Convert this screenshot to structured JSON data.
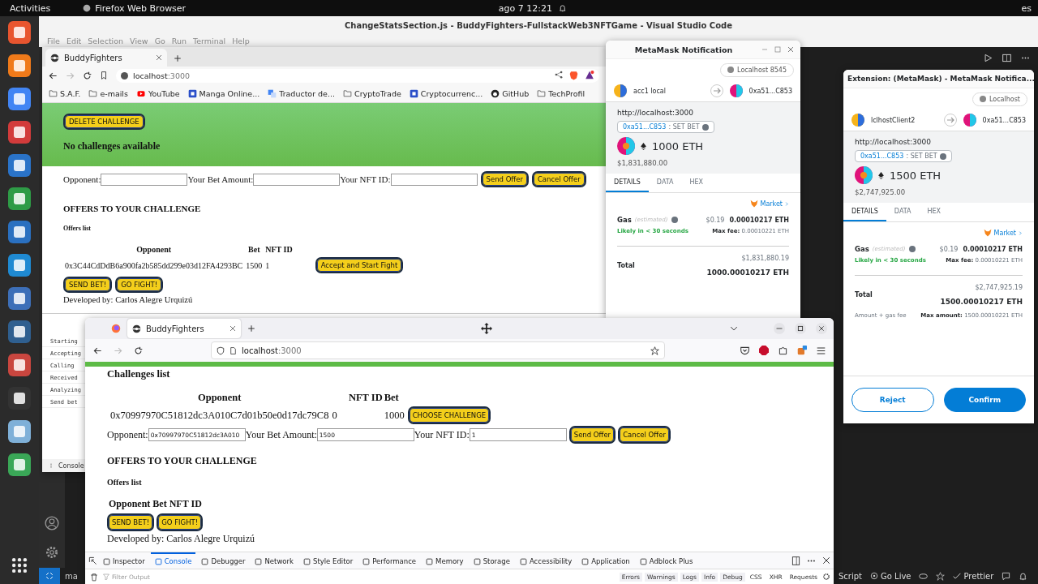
{
  "top_bar": {
    "activities": "Activities",
    "app_name": "Firefox Web Browser",
    "clock": "ago 7  12:21",
    "input_source": "es"
  },
  "editor": {
    "title": "ChangeStatsSection.js - BuddyFighters-FullstackWeb3NFTGame - Visual Studio Code",
    "menu": [
      "File",
      "Edit",
      "Selection",
      "View",
      "Go",
      "Run",
      "Terminal",
      "Help"
    ],
    "branch": "ma",
    "status_items": [
      "Script",
      "Go Live",
      "Prettier"
    ]
  },
  "back_browser": {
    "tab": "BuddyFighters",
    "url_host": "localhost",
    "url_port": ":3000",
    "bookmarks": [
      {
        "label": "S.A.F.",
        "kind": "folder"
      },
      {
        "label": "e-mails",
        "kind": "folder"
      },
      {
        "label": "YouTube",
        "kind": "video"
      },
      {
        "label": "Manga Online...",
        "kind": "site"
      },
      {
        "label": "Traductor de...",
        "kind": "translate"
      },
      {
        "label": "CryptoTrade",
        "kind": "folder"
      },
      {
        "label": "Cryptocurrenc...",
        "kind": "site"
      },
      {
        "label": "GitHub",
        "kind": "github"
      },
      {
        "label": "TechProfil",
        "kind": "folder"
      }
    ],
    "delete_button": "DELETE CHALLENGE",
    "no_challenges": "No challenges available",
    "form": {
      "opponent_label": "Opponent:",
      "bet_label": "Your Bet Amount:",
      "nft_label": "Your NFT ID:",
      "send_offer": "Send Offer",
      "cancel_offer": "Cancel Offer"
    },
    "offers_heading": "OFFERS TO YOUR CHALLENGE",
    "offers_list": "Offers list",
    "offer_columns": [
      "Opponent",
      "Bet",
      "NFT ID"
    ],
    "offers": [
      {
        "opponent": "0x3C44CdDdB6a900fa2b585dd299e03d12FA4293BC",
        "bet": "1500",
        "nft_id": "1"
      }
    ],
    "accept_button": "Accept and Start Fight",
    "send_bet": "SEND BET!",
    "go_fight": "GO FIGHT!",
    "footer": "Developed by: Carlos Alegre Urquizú",
    "console_lines": [
      "Starting",
      "Accepting",
      "Calling",
      "Received",
      "Analyzing",
      "Send bet"
    ],
    "console_tab": "Console"
  },
  "metamask_windows": [
    {
      "title": "MetaMask Notification",
      "network": "Localhost 8545",
      "from": "acc1 local",
      "to": "0xa51...C853",
      "origin": "http://localhost:3000",
      "contract": "0xa51...C853",
      "method": ": SET BET",
      "amount": "1000 ETH",
      "fiat": "$1,831,880.00",
      "tabs": [
        {
          "label": "DETAILS",
          "selected": true
        },
        {
          "label": "DATA",
          "selected": false
        },
        {
          "label": "HEX",
          "selected": false
        }
      ],
      "market": "Market",
      "gas_label": "Gas",
      "gas_note": "(estimated)",
      "gas_fiat": "$0.19",
      "gas_eth": "0.00010217 ETH",
      "likely": "Likely in < 30 seconds",
      "max_fee_label": "Max fee:",
      "max_fee": "0.00010221 ETH",
      "total_label": "Total",
      "total_fiat": "$1,831,880.19",
      "total_eth": "1000.00010217 ETH"
    },
    {
      "title": "Extension: (MetaMask) - MetaMask Notifica...",
      "network": "Localhost",
      "from": "lclhostClient2",
      "to": "0xa51...C853",
      "origin": "http://localhost:3000",
      "contract": "0xa51...C853",
      "method": ": SET BET",
      "amount": "1500 ETH",
      "fiat": "$2,747,925.00",
      "tabs": [
        {
          "label": "DETAILS",
          "selected": true
        },
        {
          "label": "DATA",
          "selected": false
        },
        {
          "label": "HEX",
          "selected": false
        }
      ],
      "market": "Market",
      "gas_label": "Gas",
      "gas_note": "(estimated)",
      "gas_fiat": "$0.19",
      "gas_eth": "0.00010217 ETH",
      "likely": "Likely in < 30 seconds",
      "max_fee_label": "Max fee:",
      "max_fee": "0.00010221 ETH",
      "total_label": "Total",
      "total_fiat": "$2,747,925.19",
      "total_eth": "1500.00010217 ETH",
      "amount_gas": "Amount + gas fee",
      "max_amount_label": "Max amount:",
      "max_amount": "1500.00010221 ETH",
      "reject": "Reject",
      "confirm": "Confirm"
    }
  ],
  "front_browser": {
    "tab": "BuddyFighters",
    "url_host": "localhost",
    "url_port": ":3000",
    "challenges_heading": "Challenges list",
    "challenge_columns": [
      "Opponent",
      "NFT ID",
      "Bet"
    ],
    "challenges": [
      {
        "opponent": "0x70997970C51812dc3A010C7d01b50e0d17dc79C8",
        "nft_id": "0",
        "bet": "1000"
      }
    ],
    "choose_button": "CHOOSE CHALLENGE",
    "form": {
      "opponent_label": "Opponent:",
      "opponent_value": "0x70997970C51812dc3A010",
      "bet_label": "Your Bet Amount:",
      "bet_value": "1500",
      "nft_label": "Your NFT ID:",
      "nft_value": "1",
      "send_offer": "Send Offer",
      "cancel_offer": "Cancel Offer"
    },
    "offers_heading": "OFFERS TO YOUR CHALLENGE",
    "offers_list": "Offers list",
    "offer_header": "Opponent Bet NFT ID",
    "send_bet": "SEND BET!",
    "go_fight": "GO FIGHT!",
    "footer": "Developed by: Carlos Alegre Urquizú",
    "devtools_tabs": [
      {
        "label": "Inspector",
        "selected": false
      },
      {
        "label": "Console",
        "selected": true
      },
      {
        "label": "Debugger",
        "selected": false
      },
      {
        "label": "Network",
        "selected": false
      },
      {
        "label": "Style Editor",
        "selected": false
      },
      {
        "label": "Performance",
        "selected": false
      },
      {
        "label": "Memory",
        "selected": false
      },
      {
        "label": "Storage",
        "selected": false
      },
      {
        "label": "Accessibility",
        "selected": false
      },
      {
        "label": "Application",
        "selected": false
      },
      {
        "label": "Adblock Plus",
        "selected": false
      }
    ],
    "filter_placeholder": "Filter Output",
    "filters": [
      "Errors",
      "Warnings",
      "Logs",
      "Info",
      "Debug",
      "CSS",
      "XHR",
      "Requests"
    ]
  }
}
